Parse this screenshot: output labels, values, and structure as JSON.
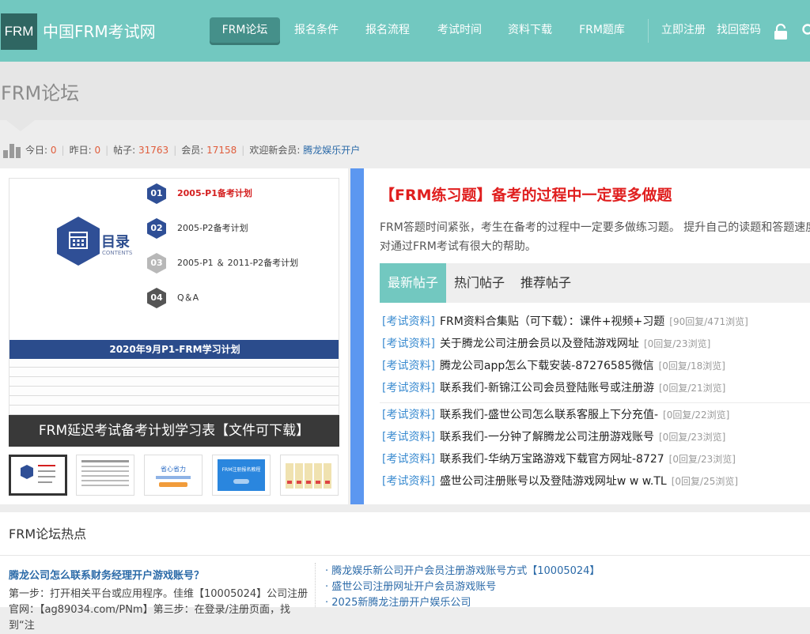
{
  "header": {
    "logo_text": "FRM",
    "site_name": "中国FRM考试网",
    "nav": [
      {
        "label": "FRM论坛",
        "active": true
      },
      {
        "label": "报名条件",
        "active": false
      },
      {
        "label": "报名流程",
        "active": false
      },
      {
        "label": "考试时间",
        "active": false
      },
      {
        "label": "资料下载",
        "active": false
      },
      {
        "label": "FRM题库",
        "active": false
      }
    ],
    "register_label": "立即注册",
    "forgot_label": "找回密码",
    "lock_icon": "lock-icon",
    "search_icon": "search-icon",
    "brand_color": "#72c8c0"
  },
  "page_title": "FRM论坛",
  "stats": {
    "today_label": "今日:",
    "today_value": "0",
    "yesterday_label": "昨日:",
    "yesterday_value": "0",
    "posts_label": "帖子:",
    "posts_value": "31763",
    "members_label": "会员:",
    "members_value": "17158",
    "welcome_label": "欢迎新会员:",
    "new_member": "腾龙娱乐开户"
  },
  "slide": {
    "toc_title": "目录",
    "toc_subtitle": "CONTENTS",
    "toc_items": [
      {
        "num": "01",
        "text": "2005-P1备考计划",
        "highlight": true
      },
      {
        "num": "02",
        "text": "2005-P2备考计划",
        "highlight": false
      },
      {
        "num": "03",
        "text": "2005-P1 ＆ 2011-P2备考计划",
        "highlight": false
      },
      {
        "num": "04",
        "text": "Q＆A",
        "highlight": false
      }
    ],
    "plan_title": "2020年9月P1-FRM学习计划",
    "caption": "FRM延迟考试备考计划学习表【文件可下载】",
    "thumbs": [
      {
        "kind": "toc"
      },
      {
        "kind": "table"
      },
      {
        "kind": "promo",
        "text": "省心省力"
      },
      {
        "kind": "blue",
        "text": "FRM注册报名教程"
      },
      {
        "kind": "books"
      }
    ]
  },
  "featured": {
    "title": "【FRM练习题】备考的过程中一定要多做题",
    "desc_line1": "FRM答题时间紧张，考生在备考的过程中一定要多做练习题。 提升自己的读题和答题速度",
    "desc_line2": "对通过FRM考试有很大的帮助。"
  },
  "tabs": [
    {
      "label": "最新帖子",
      "active": true
    },
    {
      "label": "热门帖子",
      "active": false
    },
    {
      "label": "推荐帖子",
      "active": false
    }
  ],
  "posts": [
    {
      "cat": "[考试资料]",
      "title": "FRM资料合集贴（可下载）：课件+视频+习题",
      "meta": "[90回复/471浏览]"
    },
    {
      "cat": "[考试资料]",
      "title": "关于腾龙公司注册会员以及登陆游戏网址",
      "meta": "[0回复/23浏览]"
    },
    {
      "cat": "[考试资料]",
      "title": "腾龙公司app怎么下载安装-87276585微信",
      "meta": "[0回复/18浏览]"
    },
    {
      "cat": "[考试资料]",
      "title": "联系我们-新锦江公司会员登陆账号或注册游",
      "meta": "[0回复/21浏览]"
    },
    {
      "cat": "[考试资料]",
      "title": "联系我们-盛世公司怎么联系客服上下分充值-",
      "meta": "[0回复/22浏览]"
    },
    {
      "cat": "[考试资料]",
      "title": "联系我们-一分钟了解腾龙公司注册游戏账号",
      "meta": "[0回复/23浏览]"
    },
    {
      "cat": "[考试资料]",
      "title": "联系我们-华纳万宝路游戏下载官方网址-8727",
      "meta": "[0回复/23浏览]"
    },
    {
      "cat": "[考试资料]",
      "title": "盛世公司注册账号以及登陆游戏网址w w w.TL",
      "meta": "[0回复/25浏览]"
    }
  ],
  "hot": {
    "title": "FRM论坛热点",
    "lead_title": "腾龙公司怎么联系财务经理开户游戏账号？",
    "lead_body": "第一步：打开相关平台或应用程序。佳维【10005024】公司注册官网：【ag89034.com/PNm】第三步：在登录/注册页面，找到“注",
    "links": [
      "· 腾龙娱乐新公司开户会员注册游戏账号方式【10005024】",
      "· 盛世公司注册网址开户会员游戏账号",
      "· 2025新腾龙注册开户娱乐公司"
    ]
  }
}
